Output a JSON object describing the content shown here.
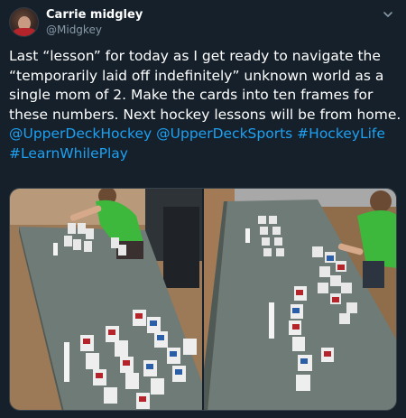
{
  "tweet": {
    "author_name": "Carrie midgley",
    "author_handle": "@Midgkey",
    "text_lines": [
      "Last “lesson” for today as I get ready to navigate the",
      "“temporarily laid off indefinitely” unknown world as a",
      "single mom of 2. Make the cards into ten frames for",
      "these numbers. Next hockey lessons will be from home."
    ],
    "mention_1": "@UpperDeckHockey",
    "mention_2": "@UpperDeckSports",
    "hashtag_1": "#HockeyLife",
    "hashtag_2": "#LearnWhilePlay"
  },
  "icons": {
    "menu": "chevron-down-icon"
  },
  "colors": {
    "background": "#15202b",
    "link": "#1da1f2",
    "secondary_text": "#8899a6",
    "table": "#6f7b76",
    "floor": "#a07850"
  }
}
